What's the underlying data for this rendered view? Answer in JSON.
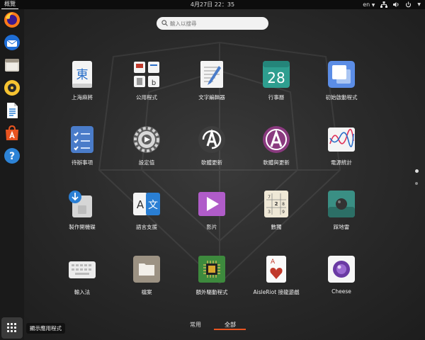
{
  "topbar": {
    "activities": "概覽",
    "clock": "4月27日  22：35",
    "lang": "en"
  },
  "dock": {
    "items": [
      {
        "name": "firefox-icon"
      },
      {
        "name": "thunderbird-icon"
      },
      {
        "name": "files-icon"
      },
      {
        "name": "rhythmbox-icon"
      },
      {
        "name": "libreoffice-writer-icon"
      },
      {
        "name": "software-icon"
      },
      {
        "name": "help-icon"
      }
    ],
    "show_apps_tooltip": "顯示應用程式"
  },
  "search": {
    "placeholder": "輸入以搜尋"
  },
  "apps": [
    {
      "label": "上海麻將",
      "icon": "mahjongg-icon"
    },
    {
      "label": "公用程式",
      "icon": "utilities-folder-icon"
    },
    {
      "label": "文字編輯器",
      "icon": "text-editor-icon"
    },
    {
      "label": "行事曆",
      "icon": "calendar-icon",
      "text": "28"
    },
    {
      "label": "初始啟動程式",
      "icon": "startup-disk-icon"
    },
    {
      "label": "待辦事項",
      "icon": "todo-icon"
    },
    {
      "label": "設定值",
      "icon": "settings-icon"
    },
    {
      "label": "軟體更新",
      "icon": "software-updater-icon"
    },
    {
      "label": "軟體與更新",
      "icon": "software-properties-icon"
    },
    {
      "label": "電源統計",
      "icon": "power-statistics-icon"
    },
    {
      "label": "製作開機碟",
      "icon": "usb-creator-icon"
    },
    {
      "label": "語言支援",
      "icon": "language-support-icon",
      "text": "A",
      "text2": "文"
    },
    {
      "label": "影片",
      "icon": "videos-icon"
    },
    {
      "label": "數獨",
      "icon": "sudoku-icon"
    },
    {
      "label": "踩地雷",
      "icon": "mines-icon"
    },
    {
      "label": "輸入法",
      "icon": "input-method-icon"
    },
    {
      "label": "檔案",
      "icon": "files-folder-icon"
    },
    {
      "label": "額外驅動程式",
      "icon": "additional-drivers-icon"
    },
    {
      "label": "AisleRiot 接龍遊戲",
      "icon": "aisleriot-icon",
      "text": "A"
    },
    {
      "label": "Cheese",
      "icon": "cheese-icon"
    }
  ],
  "mahjongg_char": "東",
  "tabs": {
    "frequent": "常用",
    "all": "全部",
    "active": "all"
  },
  "colors": {
    "accent": "#e95420",
    "background": "#2b2b2b",
    "dock": "#1a1a1a"
  }
}
